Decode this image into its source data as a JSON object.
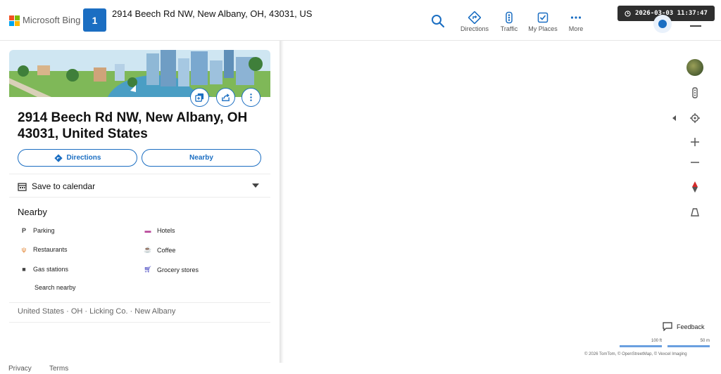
{
  "header": {
    "logo_text": "Microsoft Bing",
    "badge_label": "1",
    "search_query": "2914 Beech Rd NW, New Albany, OH, 43031, US",
    "nav": [
      {
        "label": "Directions",
        "icon": "directions-icon"
      },
      {
        "label": "Traffic",
        "icon": "traffic-icon"
      },
      {
        "label": "My Places",
        "icon": "my-places-icon"
      },
      {
        "label": "More",
        "icon": "more-icon"
      }
    ],
    "clock_text": "2026-03-03 11:37:47"
  },
  "card": {
    "title": "2914 Beech Rd NW, New Albany, OH 43031, United States",
    "directions_label": "Directions",
    "nearby_label": "Nearby",
    "save_to_calendar": "Save to calendar",
    "nearby_heading": "Nearby",
    "nearby_items": [
      {
        "label": "Parking",
        "icon": "parking-icon",
        "color": "#444444"
      },
      {
        "label": "Hotels",
        "icon": "hotel-icon",
        "color": "#b8479a"
      },
      {
        "label": "Restaurants",
        "icon": "restaurant-icon",
        "color": "#e07b22"
      },
      {
        "label": "Coffee",
        "icon": "coffee-icon",
        "color": "#e07b22"
      },
      {
        "label": "Gas stations",
        "icon": "gas-station-icon",
        "color": "#444444"
      },
      {
        "label": "Grocery stores",
        "icon": "cart-icon",
        "color": "#3b3bbd"
      }
    ],
    "search_nearby": "Search nearby",
    "breadcrumb": "United States · OH · Licking Co. · New Albany"
  },
  "map": {
    "feedback": "Feedback",
    "scale_ft": "100 ft",
    "scale_m": "50 m",
    "copyright": "© 2026 TomTom, © OpenStreetMap, © Vexcel Imaging"
  },
  "footer": {
    "privacy": "Privacy",
    "terms": "Terms"
  },
  "colors": {
    "accent": "#1b6ec2"
  }
}
